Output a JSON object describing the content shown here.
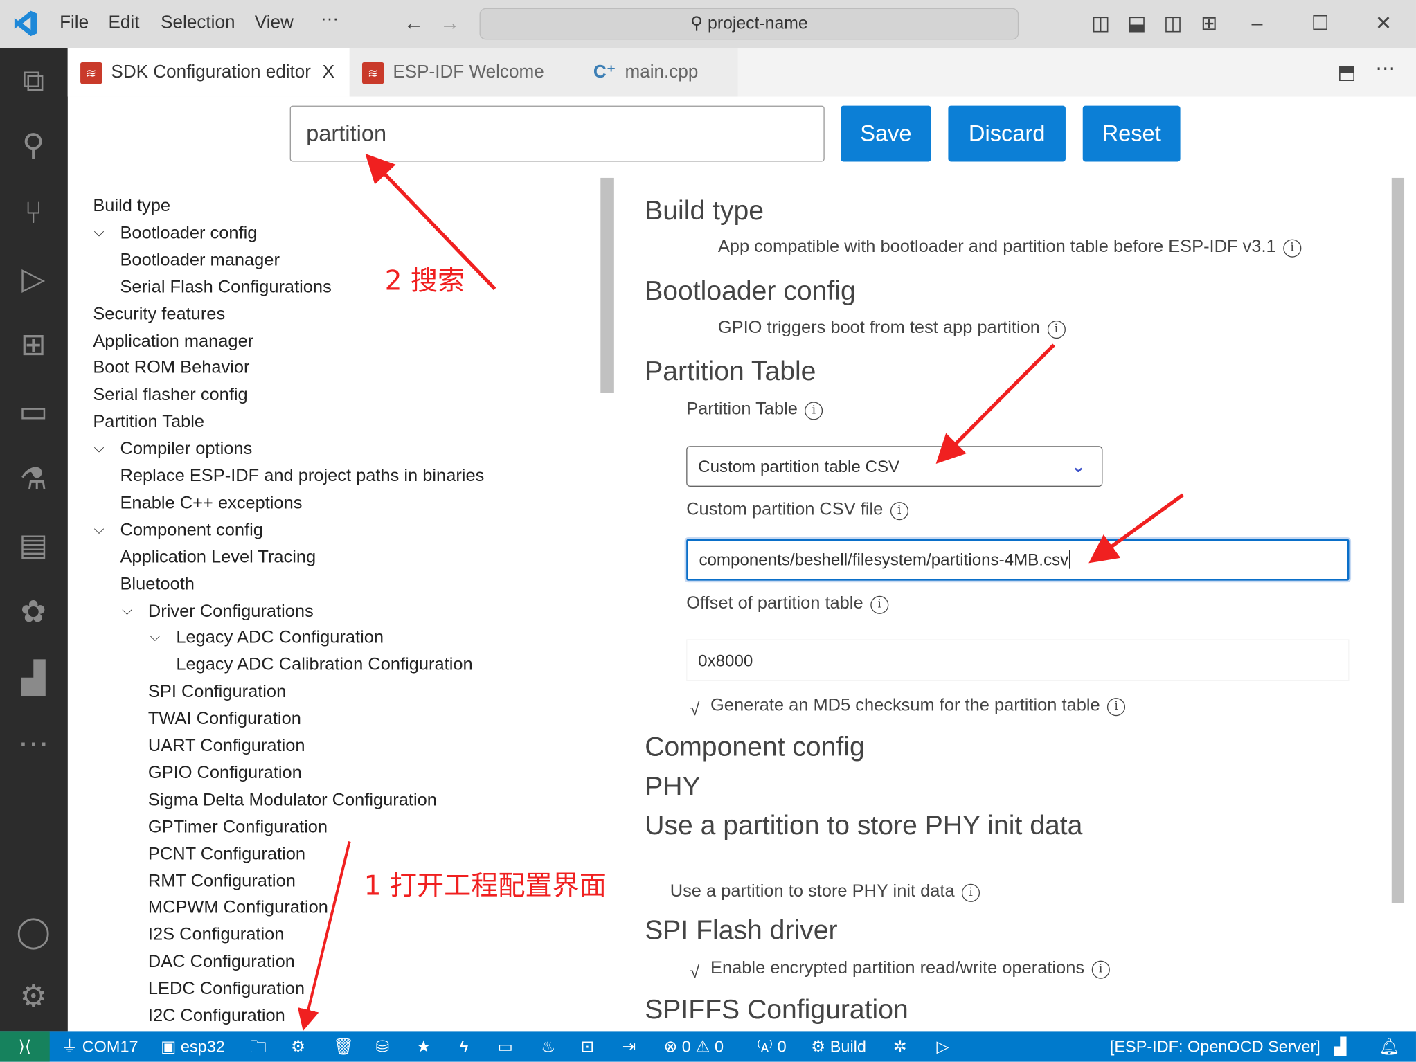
{
  "titlebar": {
    "menus": [
      "File",
      "Edit",
      "Selection",
      "View"
    ],
    "more": "···",
    "command_center": "project-name",
    "accent": "#007acc"
  },
  "tabs": [
    {
      "label": "SDK Configuration editor",
      "active": true,
      "close": "X"
    },
    {
      "label": "ESP-IDF Welcome"
    },
    {
      "label": "main.cpp"
    }
  ],
  "toolbar": {
    "search_value": "partition",
    "save_label": "Save",
    "discard_label": "Discard",
    "reset_label": "Reset",
    "button_color": "#0c7fd6"
  },
  "tree": [
    {
      "label": "Build type",
      "level": 0
    },
    {
      "label": "Bootloader config",
      "level": 1,
      "expanded": true
    },
    {
      "label": "Bootloader manager",
      "level": 1
    },
    {
      "label": "Serial Flash Configurations",
      "level": 1
    },
    {
      "label": "Security features",
      "level": 0
    },
    {
      "label": "Application manager",
      "level": 0
    },
    {
      "label": "Boot ROM Behavior",
      "level": 0
    },
    {
      "label": "Serial flasher config",
      "level": 0
    },
    {
      "label": "Partition Table",
      "level": 0
    },
    {
      "label": "Compiler options",
      "level": 1,
      "expanded": true
    },
    {
      "label": "Replace ESP-IDF and project paths in binaries",
      "level": 1
    },
    {
      "label": "Enable C++ exceptions",
      "level": 1
    },
    {
      "label": "Component config",
      "level": 1,
      "expanded": true
    },
    {
      "label": "Application Level Tracing",
      "level": 1
    },
    {
      "label": "Bluetooth",
      "level": 1
    },
    {
      "label": "Driver Configurations",
      "level": 2,
      "expanded": true
    },
    {
      "label": "Legacy ADC Configuration",
      "level": 3,
      "expanded": true
    },
    {
      "label": "Legacy ADC Calibration Configuration",
      "level": 3
    },
    {
      "label": "SPI Configuration",
      "level": 2
    },
    {
      "label": "TWAI Configuration",
      "level": 2
    },
    {
      "label": "UART Configuration",
      "level": 2
    },
    {
      "label": "GPIO Configuration",
      "level": 2
    },
    {
      "label": "Sigma Delta Modulator Configuration",
      "level": 2
    },
    {
      "label": "GPTimer Configuration",
      "level": 2
    },
    {
      "label": "PCNT Configuration",
      "level": 2
    },
    {
      "label": "RMT Configuration",
      "level": 2
    },
    {
      "label": "MCPWM Configuration",
      "level": 2
    },
    {
      "label": "I2S Configuration",
      "level": 2
    },
    {
      "label": "DAC Configuration",
      "level": 2
    },
    {
      "label": "LEDC Configuration",
      "level": 2
    },
    {
      "label": "I2C Configuration",
      "level": 2
    }
  ],
  "content": {
    "build_type": "Build type",
    "build_opt": "App compatible with bootloader and partition table before ESP-IDF v3.1",
    "bootloader": "Bootloader config",
    "bootloader_opt": "GPIO triggers boot from test app partition",
    "partition": "Partition Table",
    "partition_label": "Partition Table",
    "partition_select": "Custom partition table CSV",
    "csv_label": "Custom partition CSV file",
    "csv_value": "components/beshell/filesystem/partitions-4MB.csv",
    "offset_label": "Offset of partition table",
    "offset_value": "0x8000",
    "md5_label": "Generate an MD5 checksum for the partition table",
    "md5_checked": true,
    "component": "Component config",
    "phy": "PHY",
    "phy_sub": "Use a partition to store PHY init data",
    "phy_opt": "Use a partition to store PHY init data",
    "spi": "SPI Flash driver",
    "spi_opt": "Enable encrypted partition read/write operations",
    "spi_checked": true,
    "spiffs": "SPIFFS Configuration",
    "info": "i",
    "check": "√"
  },
  "annotations": {
    "search": "2 搜索",
    "open": "1 打开工程配置界面",
    "color": "#f02020"
  },
  "statusbar": {
    "com": "COM17",
    "target": "esp32",
    "errors": "0",
    "warnings": "0",
    "broadcast": "0",
    "build": "Build",
    "openocd": "[ESP-IDF: OpenOCD Server]",
    "remote_color": "#16825d"
  }
}
